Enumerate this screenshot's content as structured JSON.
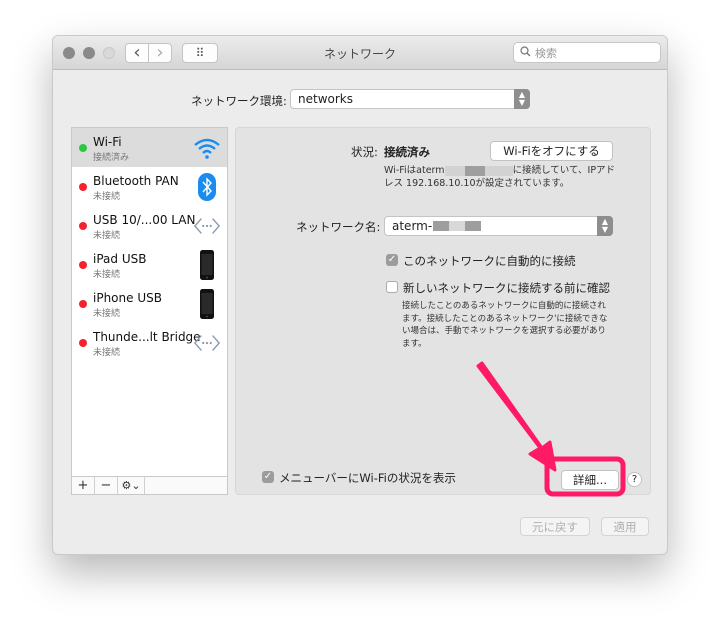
{
  "window": {
    "title": "ネットワーク",
    "search_placeholder": "検索",
    "nav_back": "‹",
    "nav_forward": "›",
    "grid_icon": "⠿"
  },
  "location": {
    "label": "ネットワーク環境:",
    "value": "networks"
  },
  "services": [
    {
      "name": "Wi-Fi",
      "status": "接続済み",
      "state_color": "#2ac840",
      "icon": "wifi-icon",
      "selected": true
    },
    {
      "name": "Bluetooth PAN",
      "status": "未接続",
      "state_color": "#f5222d",
      "icon": "bluetooth-icon",
      "selected": false
    },
    {
      "name": "USB 10/...00 LAN",
      "status": "未接続",
      "state_color": "#f5222d",
      "icon": "ethernet-icon",
      "selected": false
    },
    {
      "name": "iPad USB",
      "status": "未接続",
      "state_color": "#f5222d",
      "icon": "ipad-icon",
      "selected": false
    },
    {
      "name": "iPhone USB",
      "status": "未接続",
      "state_color": "#f5222d",
      "icon": "iphone-icon",
      "selected": false
    },
    {
      "name": "Thunde...lt Bridge",
      "status": "未接続",
      "state_color": "#f5222d",
      "icon": "ethernet-icon",
      "selected": false
    }
  ],
  "sidebar_tools": {
    "add": "+",
    "remove": "−",
    "action": "⚙⌄"
  },
  "detail": {
    "status_label": "状況:",
    "status_value": "接続済み",
    "wifi_off_button": "Wi-Fiをオフにする",
    "status_desc_1": "Wi-Fiはaterm",
    "status_desc_2": "に接続していて、IPアドレス 192.168.10.10が設定されています。",
    "network_name_label": "ネットワーク名:",
    "network_name_value": "aterm-",
    "auto_join_label": "このネットワークに自動的に接続",
    "auto_join_checked": true,
    "ask_join_label": "新しいネットワークに接続する前に確認",
    "ask_join_checked": false,
    "ask_join_desc": "接続したことのあるネットワークに自動的に接続されます。接続したことのあるネットワーク'に接続できない場合は、手動でネットワークを選択する必要があります。",
    "show_menubar_label": "メニューバーにWi-Fiの状況を表示",
    "show_menubar_checked": true,
    "advanced_button": "詳細...",
    "help_button": "?"
  },
  "footer": {
    "revert_button": "元に戻す",
    "apply_button": "適用"
  },
  "annotation": {
    "color": "#ff1a66"
  }
}
